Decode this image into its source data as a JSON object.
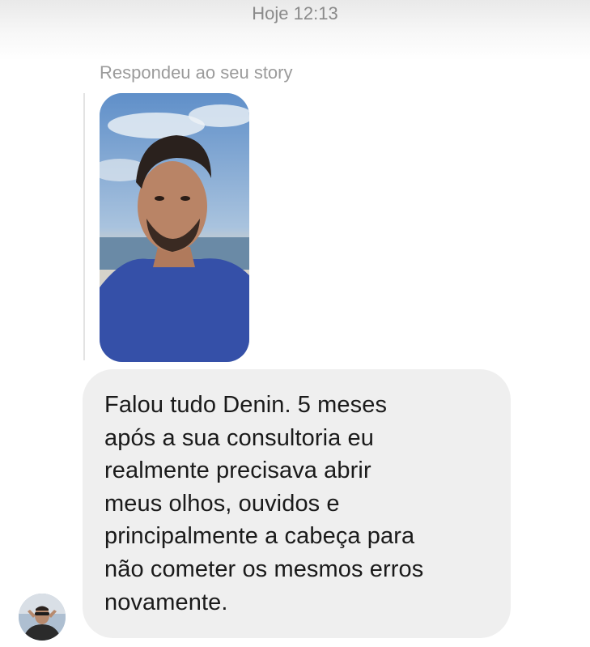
{
  "header": {
    "timestamp": "Hoje 12:13"
  },
  "story_reply": {
    "label": "Respondeu ao seu story",
    "thumbnail_icon": "story-photo"
  },
  "message": {
    "text": "Falou tudo Denin. 5 meses\napós a sua consultoria eu\nrealmente precisava abrir\nmeus olhos, ouvidos e\nprincipalmente a cabeça para\nnão cometer os mesmos erros\nnovamente."
  },
  "sender": {
    "avatar_icon": "profile-photo"
  },
  "colors": {
    "bubble": "#efefef",
    "meta_text": "#8a8a8a",
    "message_text": "#1a1a1a"
  }
}
